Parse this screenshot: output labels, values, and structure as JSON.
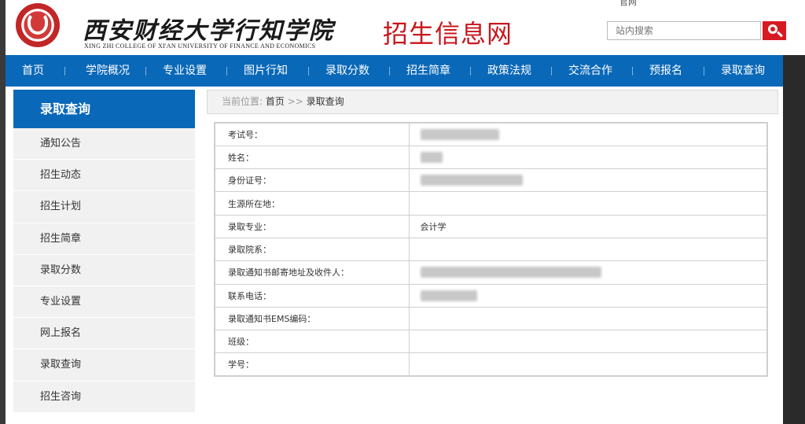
{
  "header": {
    "logo_calligraphy": "西安财经大学行知学院",
    "logo_english": "XING ZHI COLLEGE OF XI'AN UNIVERSITY OF FINANCE AND ECONOMICS",
    "site_title": "招生信息网",
    "top_link": "官网",
    "search": {
      "placeholder": "站内搜索",
      "button_icon": "search-icon"
    }
  },
  "nav": {
    "items": [
      {
        "label": "首页"
      },
      {
        "label": "学院概况"
      },
      {
        "label": "专业设置"
      },
      {
        "label": "图片行知"
      },
      {
        "label": "录取分数"
      },
      {
        "label": "招生简章"
      },
      {
        "label": "政策法规"
      },
      {
        "label": "交流合作"
      },
      {
        "label": "预报名"
      },
      {
        "label": "录取查询"
      }
    ],
    "bg_color": "#0a68b8"
  },
  "sidebar": {
    "title": "录取查询",
    "items": [
      {
        "label": "通知公告"
      },
      {
        "label": "招生动态"
      },
      {
        "label": "招生计划"
      },
      {
        "label": "招生简章"
      },
      {
        "label": "录取分数"
      },
      {
        "label": "专业设置"
      },
      {
        "label": "网上报名"
      },
      {
        "label": "录取查询"
      },
      {
        "label": "招生咨询"
      }
    ]
  },
  "breadcrumb": {
    "prefix": "当前位置:",
    "home": "首页",
    "sep": ">>",
    "current": "录取查询"
  },
  "result": {
    "rows": [
      {
        "label": "考试号：",
        "value": "",
        "redacted": true
      },
      {
        "label": "姓名：",
        "value": "",
        "redacted": true
      },
      {
        "label": "身份证号：",
        "value": "",
        "redacted": true
      },
      {
        "label": "生源所在地：",
        "value": ""
      },
      {
        "label": "录取专业：",
        "value": "会计学"
      },
      {
        "label": "录取院系：",
        "value": ""
      },
      {
        "label": "录取通知书邮寄地址及收件人：",
        "value": "",
        "redacted": true
      },
      {
        "label": "联系电话：",
        "value": "",
        "redacted": true
      },
      {
        "label": "录取通知书EMS编码：",
        "value": ""
      },
      {
        "label": "班级：",
        "value": ""
      },
      {
        "label": "学号：",
        "value": ""
      }
    ]
  }
}
